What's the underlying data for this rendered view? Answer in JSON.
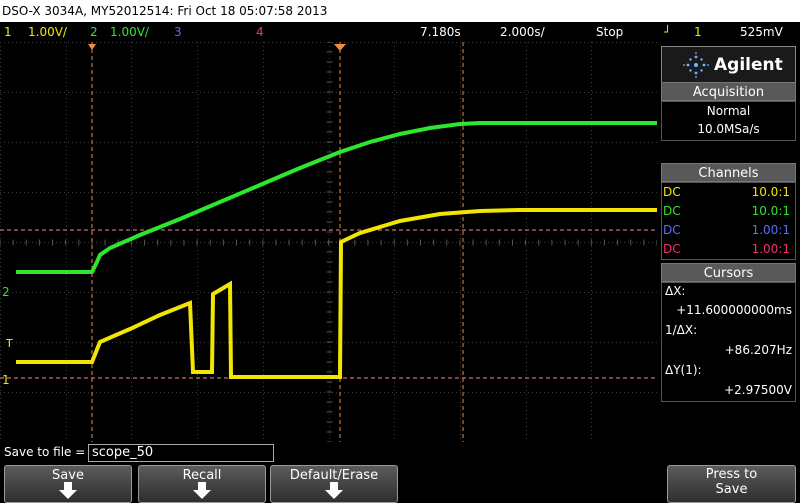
{
  "title_bar": "DSO-X 3034A, MY52012514: Fri Oct 18 05:07:58 2013",
  "status": {
    "ch1_num": "1",
    "ch1_scale": "1.00V/",
    "ch2_num": "2",
    "ch2_scale": "1.00V/",
    "ch3_num": "3",
    "ch4_num": "4",
    "time_delay": "7.180s",
    "time_scale": "2.000s/",
    "run_state": "Stop",
    "trigger_source": "1",
    "trigger_level": "525mV"
  },
  "colors": {
    "ch1": "#f2e600",
    "ch2": "#2ee62e",
    "ch3": "#5a6cf0",
    "ch4": "#f0326e",
    "cursor": "#f08c3c"
  },
  "brand": "Agilent",
  "acquisition": {
    "header": "Acquisition",
    "mode": "Normal",
    "rate": "10.0MSa/s"
  },
  "channels": {
    "header": "Channels",
    "rows": [
      {
        "coupling": "DC",
        "probe": "10.0:1"
      },
      {
        "coupling": "DC",
        "probe": "10.0:1"
      },
      {
        "coupling": "DC",
        "probe": "1.00:1"
      },
      {
        "coupling": "DC",
        "probe": "1.00:1"
      }
    ]
  },
  "cursors": {
    "header": "Cursors",
    "dx_label": "ΔX:",
    "dx_value": "+11.600000000ms",
    "inv_label": "1/ΔX:",
    "inv_value": "+86.207Hz",
    "dy_label": "ΔY(1):",
    "dy_value": "+2.97500V"
  },
  "display_markers": {
    "ch2_marker": "2",
    "trigger_marker": "T",
    "ch1_marker": "1"
  },
  "save": {
    "label": "Save to file =",
    "filename": "scope_50"
  },
  "softkeys": [
    {
      "label": "Save"
    },
    {
      "label": "Recall"
    },
    {
      "label": "Default/Erase"
    },
    {
      "label": "Press to\nSave"
    }
  ]
}
